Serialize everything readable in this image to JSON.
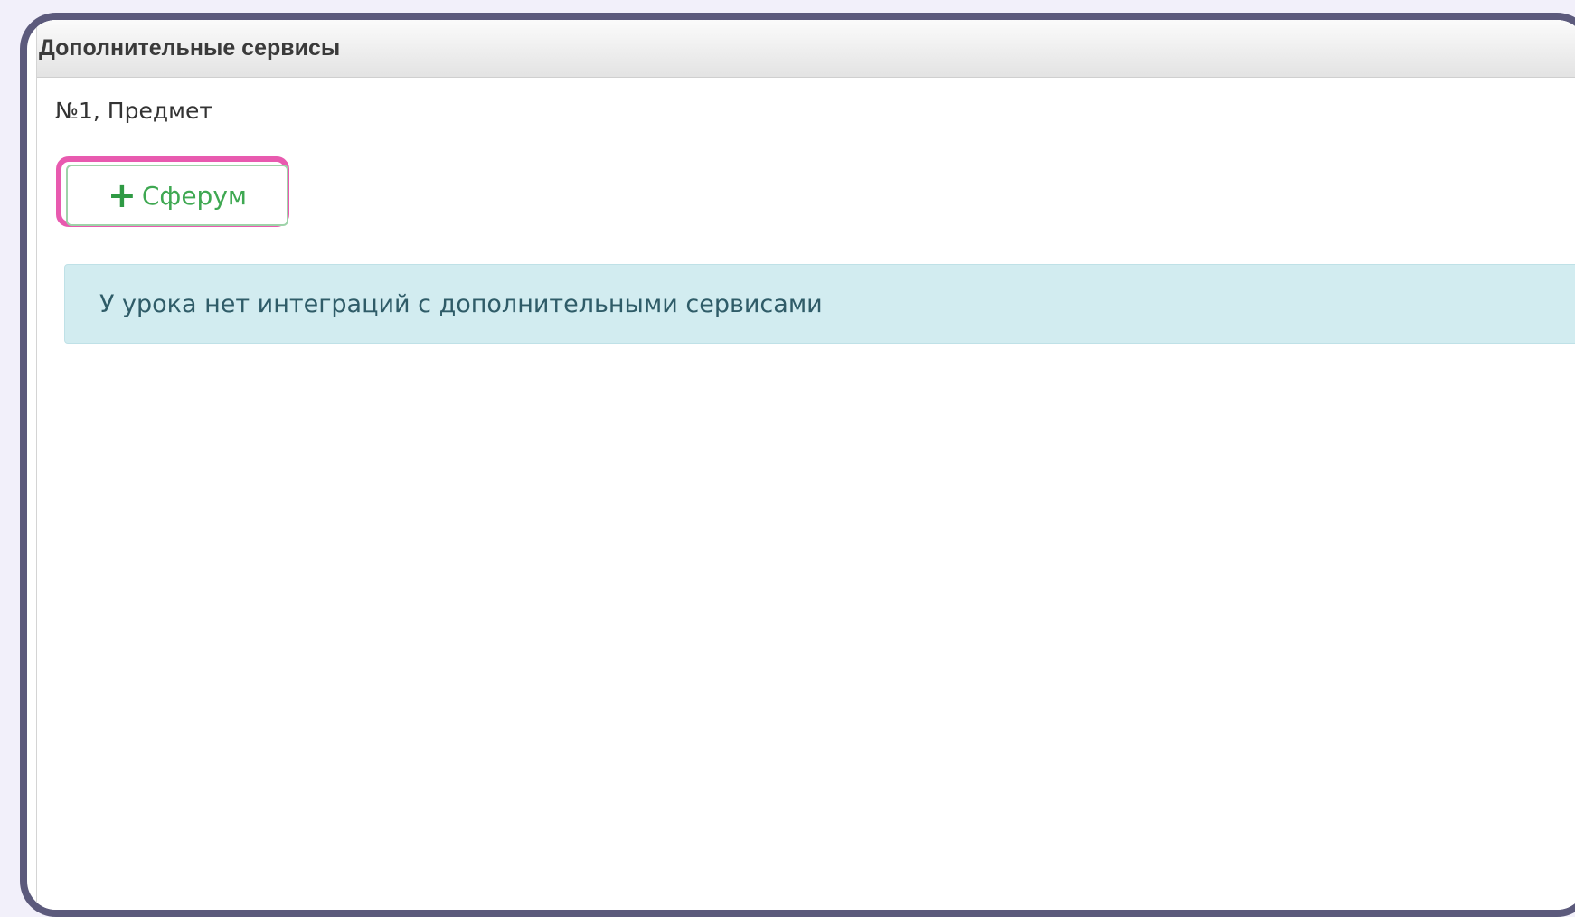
{
  "panel": {
    "title": "Дополнительные сервисы"
  },
  "lesson": {
    "label": "№1, Предмет"
  },
  "add_button": {
    "icon": "plus-icon",
    "label": "Сферум"
  },
  "alert": {
    "text": "У урока нет интеграций с дополнительными сервисами"
  },
  "colors": {
    "frame_border": "#5c5a7c",
    "highlight": "#e85aaf",
    "button_text": "#3fa852",
    "alert_bg": "#d2ecf0"
  }
}
